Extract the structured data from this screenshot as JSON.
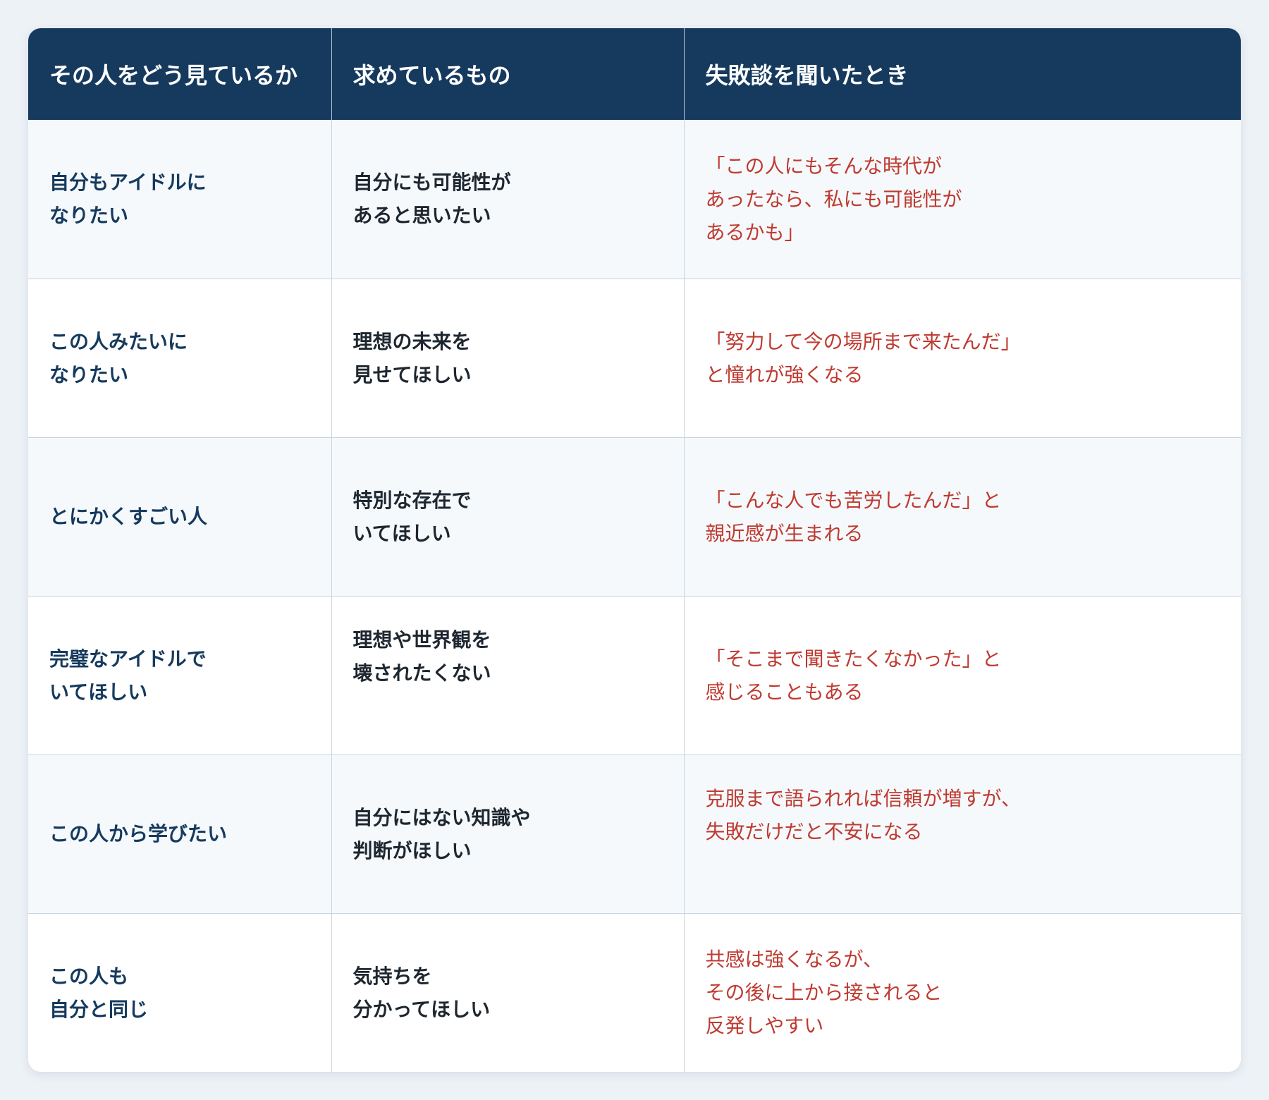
{
  "table": {
    "headers": [
      "その人をどう見ているか",
      "求めているもの",
      "失敗談を聞いたとき"
    ],
    "rows": [
      {
        "view": [
          "自分もアイドルに",
          "なりたい"
        ],
        "want": [
          "自分にも可能性が",
          "あると思いたい"
        ],
        "fail": [
          "「この人にもそんな時代が",
          "あったなら、私にも可能性が",
          "あるかも」"
        ]
      },
      {
        "view": [
          "この人みたいに",
          "なりたい"
        ],
        "want": [
          "理想の未来を",
          "見せてほしい"
        ],
        "fail": [
          "「努力して今の場所まで来たんだ」",
          "と憧れが強くなる"
        ]
      },
      {
        "view": [
          "とにかくすごい人"
        ],
        "want": [
          "特別な存在で",
          "いてほしい"
        ],
        "fail": [
          "「こんな人でも苦労したんだ」と",
          "親近感が生まれる"
        ]
      },
      {
        "view": [
          "完璧なアイドルで",
          "いてほしい"
        ],
        "want": [
          "理想や世界観を",
          "壊されたくない"
        ],
        "fail": [
          "「そこまで聞きたくなかった」と",
          "感じることもある"
        ]
      },
      {
        "view": [
          "この人から学びたい"
        ],
        "want": [
          "自分にはない知識や",
          "判断がほしい"
        ],
        "fail": [
          "克服まで語られれば信頼が増すが、",
          "失敗だけだと不安になる"
        ]
      },
      {
        "view": [
          "この人も",
          "自分と同じ"
        ],
        "want": [
          "気持ちを",
          "分かってほしい"
        ],
        "fail": [
          "共感は強くなるが、",
          "その後に上から接されると",
          "反発しやすい"
        ]
      }
    ]
  }
}
